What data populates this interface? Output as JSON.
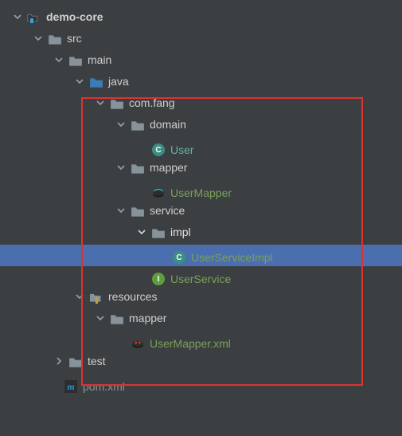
{
  "tree": {
    "root": "demo-core",
    "src": "src",
    "main": "main",
    "java": "java",
    "pkg": "com.fang",
    "domain": "domain",
    "user": "User",
    "mapper": "mapper",
    "usermapper": "UserMapper",
    "service": "service",
    "impl": "impl",
    "userserviceimpl": "UserServiceImpl",
    "userservice": "UserService",
    "resources": "resources",
    "resources_mapper": "mapper",
    "usermapper_xml": "UserMapper.xml",
    "test": "test",
    "pom": "pom.xml"
  }
}
